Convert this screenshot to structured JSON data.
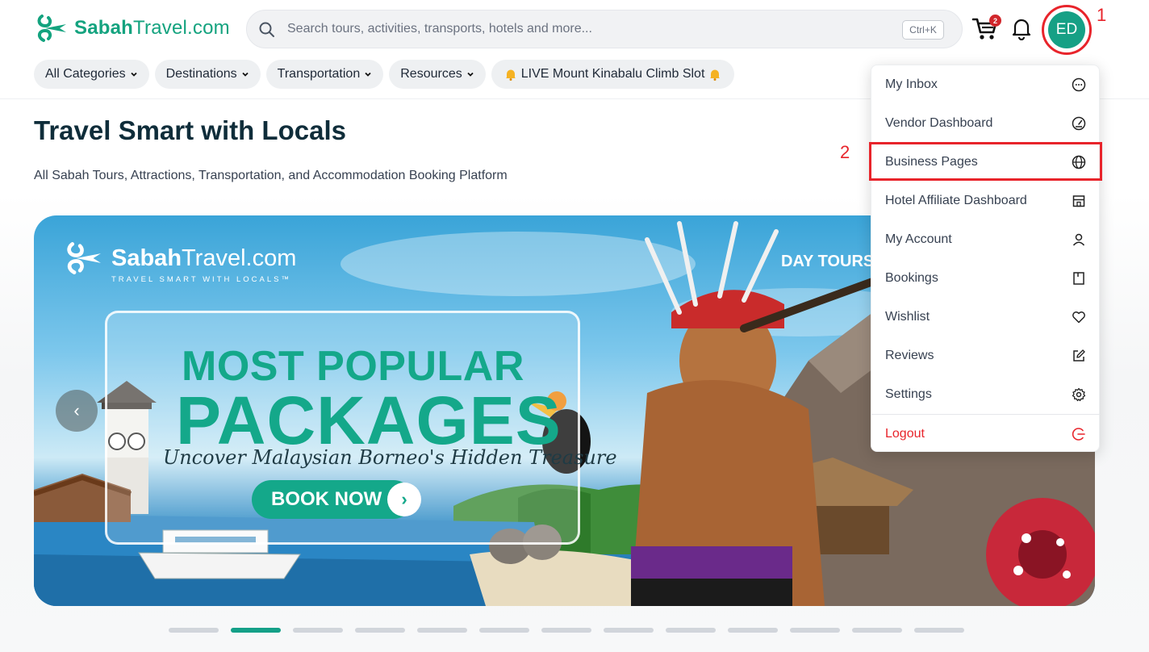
{
  "header": {
    "logo_text_bold": "Sabah",
    "logo_text_regular": "Travel.com",
    "search_placeholder": "Search tours, activities, transports, hotels and more...",
    "search_shortcut": "Ctrl+K",
    "cart_count": "2",
    "avatar_initials": "ED",
    "annotation_1": "1",
    "annotation_2": "2"
  },
  "nav": {
    "items": [
      {
        "label": "All Categories",
        "has_chevron": true
      },
      {
        "label": "Destinations",
        "has_chevron": true
      },
      {
        "label": "Transportation",
        "has_chevron": true
      },
      {
        "label": "Resources",
        "has_chevron": true
      },
      {
        "label": "LIVE Mount Kinabalu Climb Slot",
        "has_chevron": false,
        "icon": "bell-emoji"
      }
    ]
  },
  "hero": {
    "title": "Travel Smart with Locals",
    "subtitle": "All Sabah Tours, Attractions, Transportation, and Accommodation Booking Platform"
  },
  "banner": {
    "logo_bold": "Sabah",
    "logo_regular": "Travel.com",
    "logo_tag": "TRAVEL SMART WITH LOCALS™",
    "corner_label": "DAY TOURS",
    "headline_1": "MOST POPULAR",
    "headline_2": "PACKAGES",
    "tagline": "Uncover Malaysian Borneo's Hidden Treasure",
    "cta": "BOOK NOW",
    "slide_count": 13,
    "active_slide": 2
  },
  "menu": {
    "items": [
      {
        "label": "My Inbox",
        "icon": "chat-bubble-icon"
      },
      {
        "label": "Vendor Dashboard",
        "icon": "gauge-icon"
      },
      {
        "label": "Business Pages",
        "icon": "globe-icon",
        "highlighted": true
      },
      {
        "label": "Hotel Affiliate Dashboard",
        "icon": "store-icon"
      },
      {
        "label": "My Account",
        "icon": "user-icon"
      },
      {
        "label": "Bookings",
        "icon": "book-icon"
      },
      {
        "label": "Wishlist",
        "icon": "heart-icon"
      },
      {
        "label": "Reviews",
        "icon": "edit-icon"
      },
      {
        "label": "Settings",
        "icon": "gear-icon"
      },
      {
        "label": "Logout",
        "icon": "logout-icon"
      }
    ]
  },
  "colors": {
    "brand": "#14a37f",
    "annotation": "#e8242b",
    "avatar": "#16a085"
  }
}
